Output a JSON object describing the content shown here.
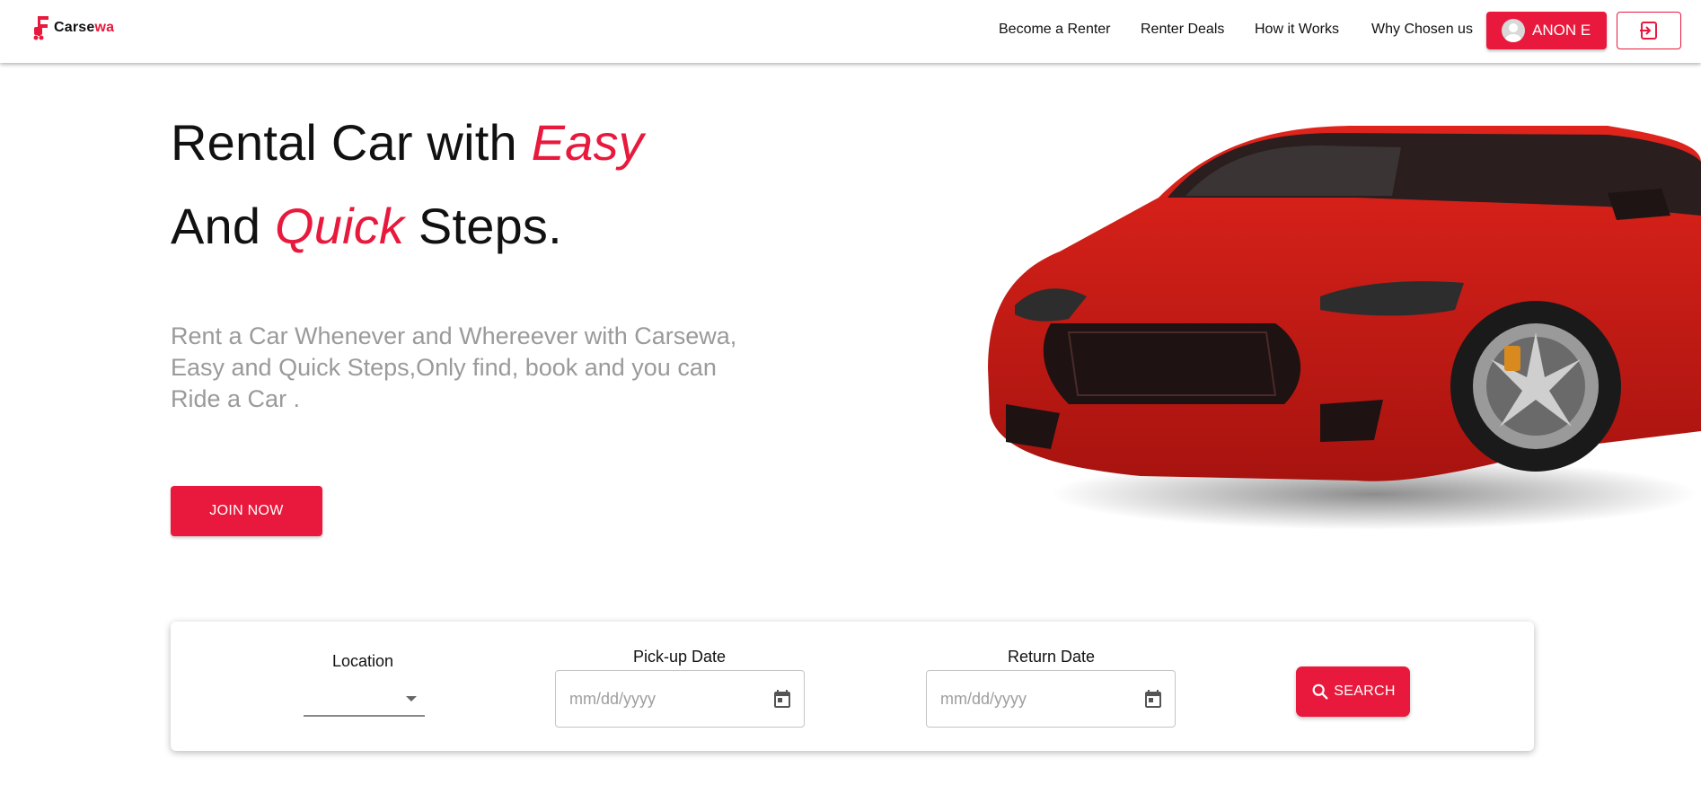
{
  "brand": {
    "name_dark": "Carse",
    "name_red": "wa",
    "logo_icon": "car-logo-icon"
  },
  "nav": {
    "links": [
      "Become a Renter",
      "Renter Deals",
      "How it Works",
      "Why Chosen us"
    ],
    "user_label": "ANON E",
    "user_icon": "account-circle-icon",
    "logout_icon": "logout-icon"
  },
  "hero": {
    "line1_prefix": "Rental Car with ",
    "line1_em": "Easy",
    "line2_prefix": "And ",
    "line2_em": "Quick",
    "line2_suffix": " Steps.",
    "subtitle": "Rent a Car Whenever and Whereever with Carsewa, Easy and Quick Steps,Only find, book and you can Ride a Car .",
    "cta": "JOIN NOW"
  },
  "search": {
    "location_label": "Location",
    "pickup_label": "Pick-up Date",
    "pickup_placeholder": "mm/dd/yyyy",
    "return_label": "Return Date",
    "return_placeholder": "mm/dd/yyyy",
    "button": "SEARCH"
  },
  "colors": {
    "accent": "#e8193c",
    "subtitle": "#9a9a9a"
  }
}
